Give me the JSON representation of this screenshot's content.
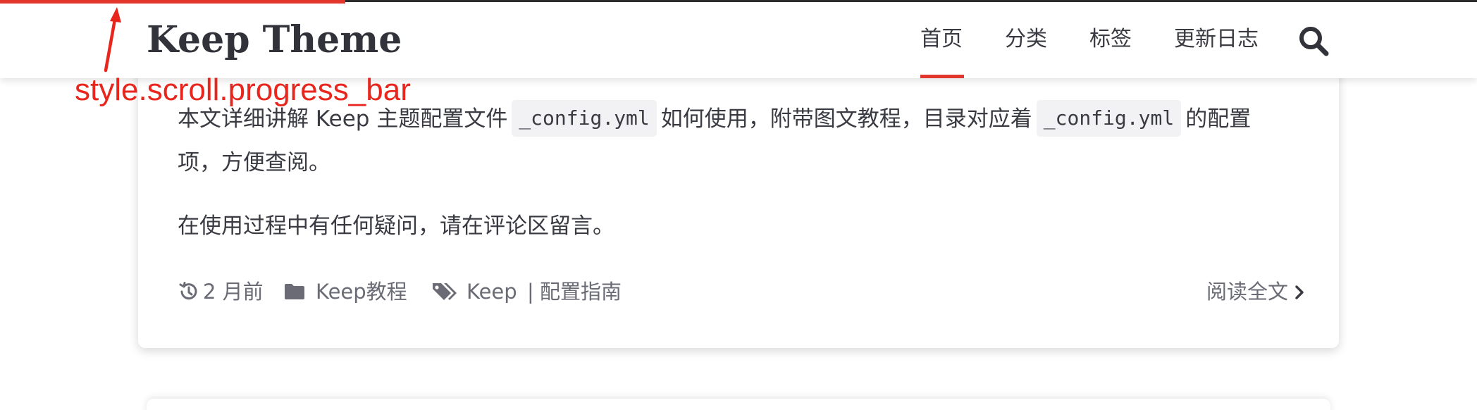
{
  "header": {
    "site_title": "Keep Theme",
    "nav": [
      {
        "label": "首页",
        "active": true
      },
      {
        "label": "分类",
        "active": false
      },
      {
        "label": "标签",
        "active": false
      },
      {
        "label": "更新日志",
        "active": false
      }
    ],
    "search_icon": "search-icon"
  },
  "scroll_progress": {
    "fraction": 0.234,
    "color": "#e2352e"
  },
  "annotation": {
    "label": "style.scroll.progress_bar",
    "color": "#e8261d"
  },
  "article": {
    "paragraph_1": {
      "text_a": "本文详细讲解 Keep 主题配置文件",
      "code_a": "_config.yml",
      "text_b": "如何使用，附带图文教程，目录对应着",
      "code_b": "_config.yml",
      "text_c": "的配置",
      "text_d": "项，方便查阅。"
    },
    "paragraph_2": "在使用过程中有任何疑问，请在评论区留言。",
    "meta": {
      "time_icon": "history-icon",
      "time": "2 月前",
      "category_icon": "folder-icon",
      "category": "Keep教程",
      "tags_icon": "tags-icon",
      "tag_1": "Keep",
      "tag_separator": "|",
      "tag_2": "配置指南"
    },
    "read_more": "阅读全文"
  },
  "colors": {
    "accent": "#e2352e",
    "text": "#3a3b42",
    "muted": "#6a6b75",
    "code_bg": "#f2f2f4"
  }
}
